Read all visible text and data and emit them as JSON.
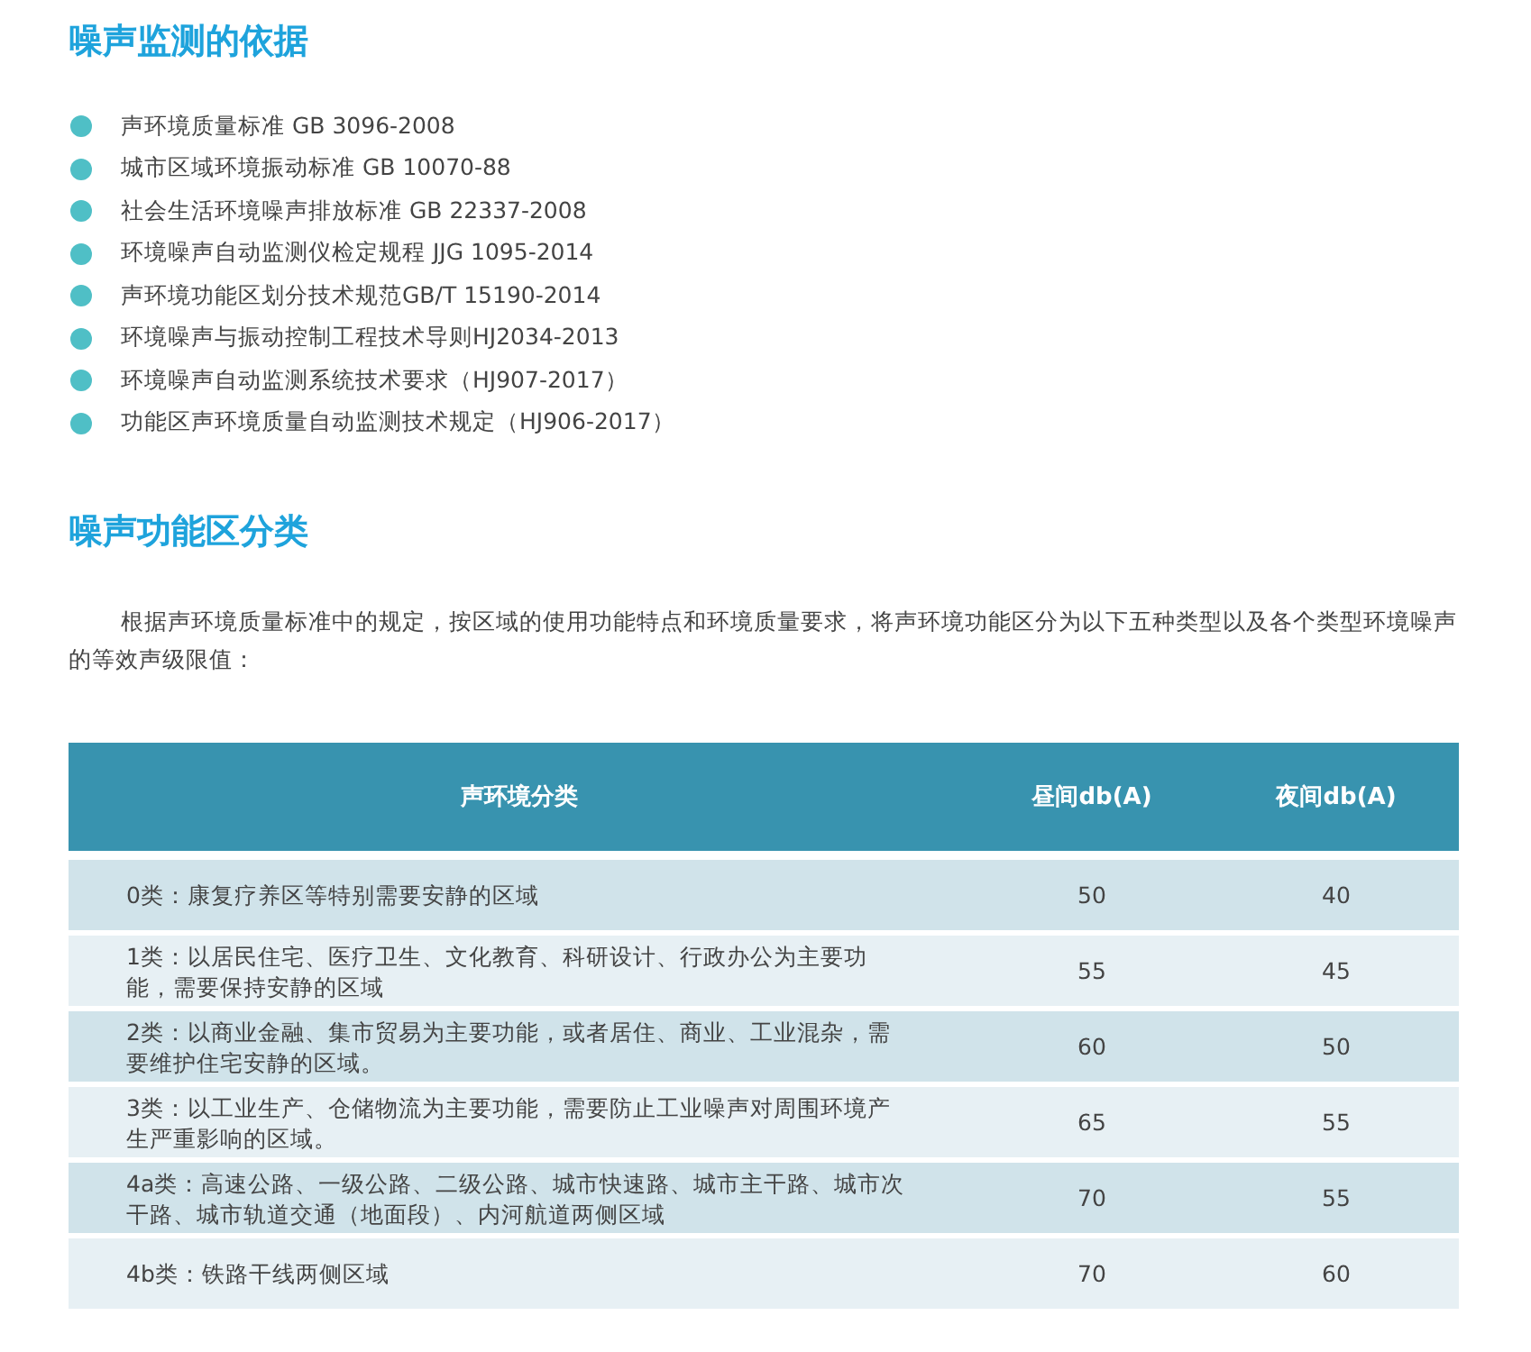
{
  "sections": [
    {
      "title": "噪声监测的依据",
      "standards": [
        "声环境质量标准 GB 3096-2008",
        "城市区域环境振动标准 GB 10070-88",
        "社会生活环境噪声排放标准 GB 22337-2008",
        "环境噪声自动监测仪检定规程 JJG 1095-2014",
        "声环境功能区划分技术规范GB/T 15190-2014",
        "环境噪声与振动控制工程技术导则HJ2034-2013",
        "环境噪声自动监测系统技术要求（HJ907-2017）",
        "功能区声环境质量自动监测技术规定（HJ906-2017）"
      ]
    },
    {
      "title": "噪声功能区分类",
      "paragraph": "根据声环境质量标准中的规定，按区域的使用功能特点和环境质量要求，将声环境功能区分为以下五种类型以及各个类型环境噪声的等效声级限值：",
      "table": {
        "columns": [
          "声环境分类",
          "昼间db(A)",
          "夜间db(A)"
        ],
        "rows": [
          {
            "category": "0类：康复疗养区等特别需要安静的区域",
            "day": "50",
            "night": "40"
          },
          {
            "category": "1类：以居民住宅、医疗卫生、文化教育、科研设计、行政办公为主要功能，需要保持安静的区域",
            "day": "55",
            "night": "45"
          },
          {
            "category": "2类：以商业金融、集市贸易为主要功能，或者居住、商业、工业混杂，需要维护住宅安静的区域。",
            "day": "60",
            "night": "50"
          },
          {
            "category": "3类：以工业生产、仓储物流为主要功能，需要防止工业噪声对周围环境产生严重影响的区域。",
            "day": "65",
            "night": "55"
          },
          {
            "category": "4a类：高速公路、一级公路、二级公路、城市快速路、城市主干路、城市次干路、城市轨道交通（地面段）、内河航道两侧区域",
            "day": "70",
            "night": "55"
          },
          {
            "category": "4b类：铁路干线两侧区域",
            "day": "70",
            "night": "60"
          }
        ]
      }
    }
  ]
}
